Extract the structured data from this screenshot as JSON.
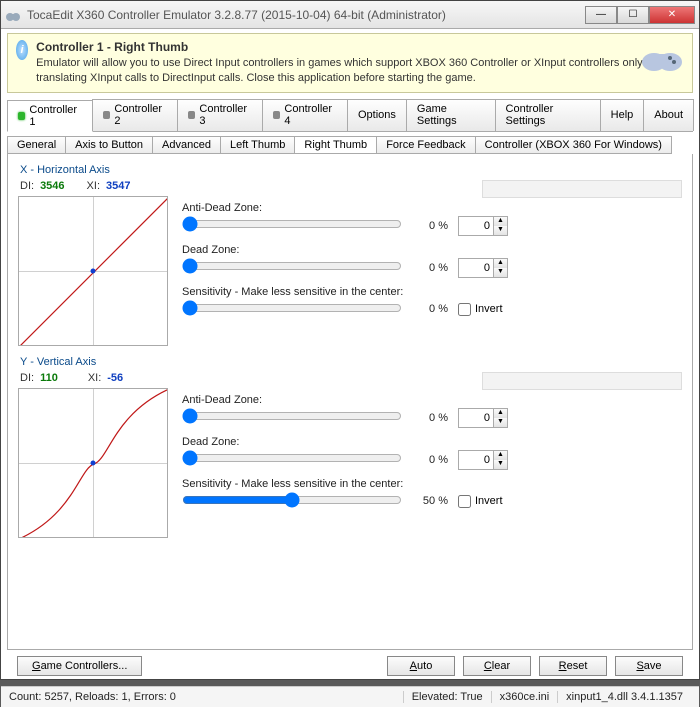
{
  "window": {
    "title": "TocaEdit X360 Controller Emulator 3.2.8.77 (2015-10-04) 64-bit (Administrator)"
  },
  "banner": {
    "title": "Controller 1 - Right Thumb",
    "text": "Emulator will allow you to use Direct Input controllers in games which support XBOX 360 Controller or XInput controllers only by translating XInput calls to DirectInput calls. Close this application before starting the game."
  },
  "main_tabs": [
    {
      "label": "Controller 1",
      "led": "green",
      "active": true
    },
    {
      "label": "Controller 2",
      "led": "off"
    },
    {
      "label": "Controller 3",
      "led": "off"
    },
    {
      "label": "Controller 4",
      "led": "off"
    },
    {
      "label": "Options"
    },
    {
      "label": "Game Settings"
    },
    {
      "label": "Controller Settings"
    },
    {
      "label": "Help"
    },
    {
      "label": "About"
    }
  ],
  "sub_tabs": [
    "General",
    "Axis to Button",
    "Advanced",
    "Left Thumb",
    "Right Thumb",
    "Force Feedback",
    "Controller (XBOX 360 For Windows)"
  ],
  "sub_tab_active": "Right Thumb",
  "x_axis": {
    "title": "X - Horizontal Axis",
    "di_label": "DI:",
    "di_value": "3546",
    "xi_label": "XI:",
    "xi_value": "3547",
    "anti_dead_label": "Anti-Dead Zone:",
    "anti_dead_pct": "0 %",
    "anti_dead_spin": "0",
    "dead_label": "Dead Zone:",
    "dead_pct": "0 %",
    "dead_spin": "0",
    "sens_label": "Sensitivity - Make less sensitive in the center:",
    "sens_pct": "0 %",
    "invert_label": "Invert",
    "invert": false,
    "slider_anti": 0,
    "slider_dead": 0,
    "slider_sens": 0
  },
  "y_axis": {
    "title": "Y - Vertical Axis",
    "di_label": "DI:",
    "di_value": "110",
    "xi_label": "XI:",
    "xi_value": "-56",
    "anti_dead_label": "Anti-Dead Zone:",
    "anti_dead_pct": "0 %",
    "anti_dead_spin": "0",
    "dead_label": "Dead Zone:",
    "dead_pct": "0 %",
    "dead_spin": "0",
    "sens_label": "Sensitivity - Make less sensitive in the center:",
    "sens_pct": "50 %",
    "invert_label": "Invert",
    "invert": false,
    "slider_anti": 0,
    "slider_dead": 0,
    "slider_sens": 50
  },
  "buttons": {
    "game_controllers": "Game Controllers...",
    "auto": "Auto",
    "clear": "Clear",
    "reset": "Reset",
    "save": "Save"
  },
  "status": {
    "left": "Count: 5257, Reloads: 1, Errors: 0",
    "elevated": "Elevated: True",
    "ini": "x360ce.ini",
    "dll": "xinput1_4.dll 3.4.1.1357"
  }
}
